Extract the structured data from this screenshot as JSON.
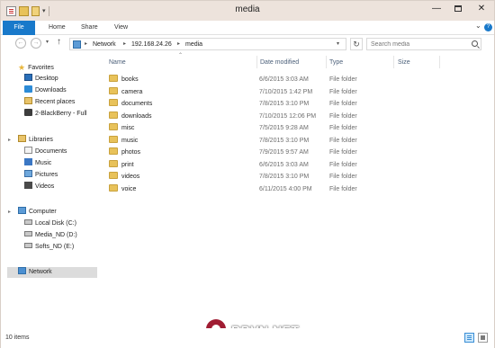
{
  "window": {
    "title": "media",
    "min_glyph": "—",
    "close_glyph": "✕"
  },
  "ribbon": {
    "tabs": [
      "File",
      "Home",
      "Share",
      "View"
    ],
    "help_glyph": "?"
  },
  "address_bar": {
    "segments": [
      "Network",
      "192.168.24.26",
      "media"
    ],
    "separator": "▸"
  },
  "search": {
    "placeholder": "Search media"
  },
  "nav_pane": {
    "favorites": {
      "label": "Favorites",
      "items": [
        "Desktop",
        "Downloads",
        "Recent places",
        "2-BlackBerry - Full"
      ]
    },
    "libraries": {
      "label": "Libraries",
      "items": [
        "Documents",
        "Music",
        "Pictures",
        "Videos"
      ]
    },
    "computer": {
      "label": "Computer",
      "items": [
        "Local Disk (C:)",
        "Media_ND (D:)",
        "Softs_ND (E:)"
      ]
    },
    "network": {
      "label": "Network"
    }
  },
  "file_list": {
    "columns": [
      "Name",
      "Date modified",
      "Type",
      "Size"
    ],
    "rows": [
      {
        "name": "books",
        "date": "6/6/2015 3:03 AM",
        "type": "File folder",
        "size": ""
      },
      {
        "name": "camera",
        "date": "7/10/2015 1:42 PM",
        "type": "File folder",
        "size": ""
      },
      {
        "name": "documents",
        "date": "7/8/2015 3:10 PM",
        "type": "File folder",
        "size": ""
      },
      {
        "name": "downloads",
        "date": "7/10/2015 12:06 PM",
        "type": "File folder",
        "size": ""
      },
      {
        "name": "misc",
        "date": "7/5/2015 9:28 AM",
        "type": "File folder",
        "size": ""
      },
      {
        "name": "music",
        "date": "7/8/2015 3:10 PM",
        "type": "File folder",
        "size": ""
      },
      {
        "name": "photos",
        "date": "7/9/2015 9:57 AM",
        "type": "File folder",
        "size": ""
      },
      {
        "name": "print",
        "date": "6/6/2015 3:03 AM",
        "type": "File folder",
        "size": ""
      },
      {
        "name": "videos",
        "date": "7/8/2015 3:10 PM",
        "type": "File folder",
        "size": ""
      },
      {
        "name": "voice",
        "date": "6/11/2015 4:00 PM",
        "type": "File folder",
        "size": ""
      }
    ]
  },
  "status_bar": {
    "item_count": "10 items"
  },
  "watermark": {
    "text": "BBVN.NET"
  },
  "colors": {
    "accent": "#1979ca",
    "folder": "#e8c25a",
    "selection": "#dcdcdc"
  }
}
